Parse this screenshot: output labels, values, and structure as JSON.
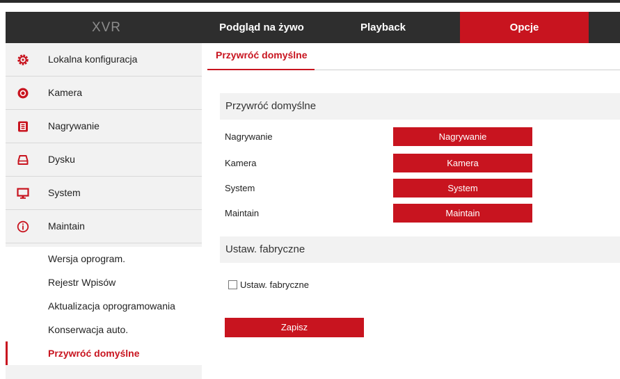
{
  "app": {
    "brand": "XVR",
    "nav_tabs": [
      {
        "label": "Podgląd na żywo",
        "active": false
      },
      {
        "label": "Playback",
        "active": false
      },
      {
        "label": "Opcje",
        "active": true
      }
    ],
    "accent_color": "#c8141f"
  },
  "sidebar": {
    "items": [
      {
        "label": "Lokalna konfiguracja",
        "icon": "gear-icon"
      },
      {
        "label": "Kamera",
        "icon": "camera-icon"
      },
      {
        "label": "Nagrywanie",
        "icon": "recording-icon"
      },
      {
        "label": "Dysku",
        "icon": "disk-icon"
      },
      {
        "label": "System",
        "icon": "monitor-icon"
      },
      {
        "label": "Maintain",
        "icon": "info-icon"
      }
    ],
    "sub_items": [
      {
        "label": "Wersja oprogram.",
        "active": false
      },
      {
        "label": "Rejestr Wpisów",
        "active": false
      },
      {
        "label": "Aktualizacja oprogramowania",
        "active": false
      },
      {
        "label": "Konserwacja auto.",
        "active": false
      },
      {
        "label": "Przywróć domyślne",
        "active": true
      }
    ]
  },
  "content": {
    "tab_label": "Przywróć domyślne",
    "section1_title": "Przywróć domyślne",
    "restore_rows": [
      {
        "label": "Nagrywanie",
        "button": "Nagrywanie"
      },
      {
        "label": "Kamera",
        "button": "Kamera"
      },
      {
        "label": "System",
        "button": "System"
      },
      {
        "label": "Maintain",
        "button": "Maintain"
      }
    ],
    "section2_title": "Ustaw. fabryczne",
    "factory_checkbox_label": "Ustaw. fabryczne",
    "factory_checked": false,
    "save_label": "Zapisz"
  }
}
